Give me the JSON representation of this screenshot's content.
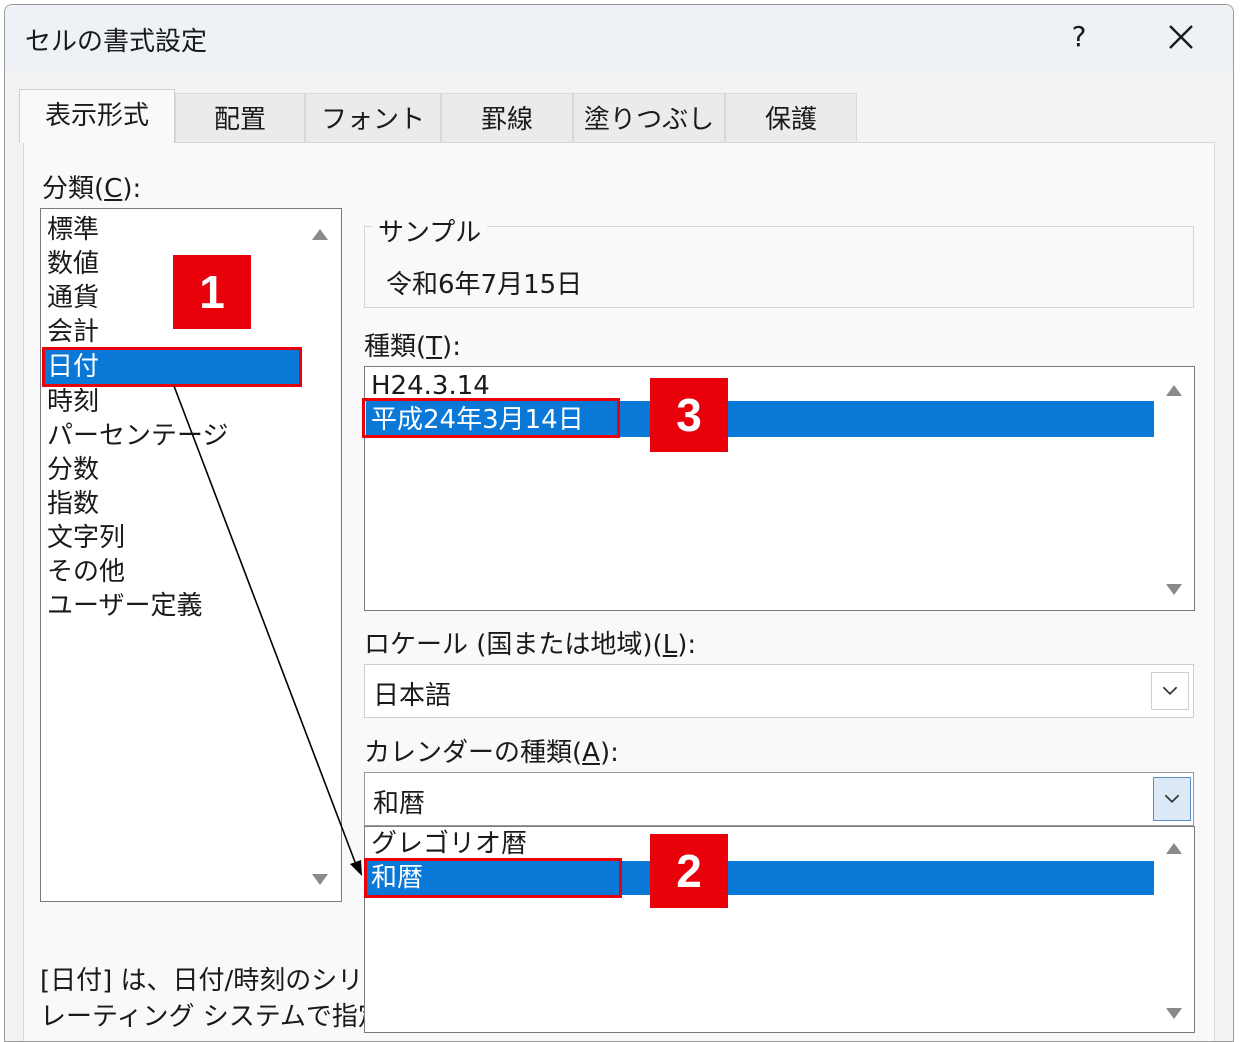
{
  "dialog": {
    "title": "セルの書式設定",
    "help_label": "?"
  },
  "tabs": [
    {
      "label": "表示形式",
      "active": true
    },
    {
      "label": "配置"
    },
    {
      "label": "フォント"
    },
    {
      "label": "罫線"
    },
    {
      "label": "塗りつぶし"
    },
    {
      "label": "保護"
    }
  ],
  "category": {
    "label_pre": "分類(",
    "label_key": "C",
    "label_post": "):",
    "items": [
      "標準",
      "数値",
      "通貨",
      "会計",
      "日付",
      "時刻",
      "パーセンテージ",
      "分数",
      "指数",
      "文字列",
      "その他",
      "ユーザー定義"
    ],
    "selected": "日付"
  },
  "sample": {
    "label": "サンプル",
    "value": "令和6年7月15日"
  },
  "type": {
    "label_pre": "種類(",
    "label_key": "T",
    "label_post": "):",
    "items": [
      "H24.3.14",
      "平成24年3月14日"
    ],
    "selected": "平成24年3月14日"
  },
  "locale": {
    "label_pre": "ロケール (国または地域)(",
    "label_key": "L",
    "label_post": "):",
    "value": "日本語"
  },
  "calendar": {
    "label_pre": "カレンダーの種類(",
    "label_key": "A",
    "label_post": "):",
    "value": "和暦",
    "options": [
      "グレゴリオ暦",
      "和暦"
    ],
    "selected": "和暦"
  },
  "description": {
    "line1": "[日付] は、日付/時刻のシリア",
    "line2": "レーティング システムで指定する"
  },
  "annotations": {
    "step1": "1",
    "step2": "2",
    "step3": "3"
  },
  "colors": {
    "selection": "#0a78d7",
    "annotation": "#e8000b"
  }
}
